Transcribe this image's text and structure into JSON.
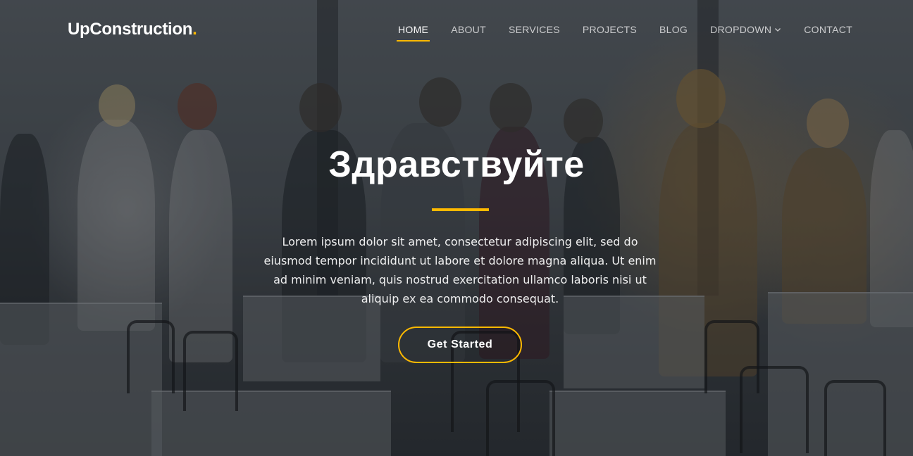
{
  "header": {
    "logo_text": "UpConstruction",
    "logo_dot": "."
  },
  "nav": {
    "items": [
      {
        "label": "HOME",
        "active": true
      },
      {
        "label": "ABOUT",
        "active": false
      },
      {
        "label": "SERVICES",
        "active": false
      },
      {
        "label": "PROJECTS",
        "active": false
      },
      {
        "label": "BLOG",
        "active": false
      },
      {
        "label": "DROPDOWN",
        "active": false,
        "icon": "chevron-down-icon"
      },
      {
        "label": "CONTACT",
        "active": false
      }
    ]
  },
  "hero": {
    "title": "Здравствуйте",
    "text": "Lorem ipsum dolor sit amet, consectetur adipiscing elit, sed do eiusmod tempor incididunt ut labore et dolore magna aliqua. Ut enim ad minim veniam, quis nostrud exercitation ullamco laboris nisi ut aliquip ex ea commodo consequat.",
    "cta_label": "Get Started"
  },
  "colors": {
    "accent": "#feb900",
    "text": "#ffffff"
  }
}
